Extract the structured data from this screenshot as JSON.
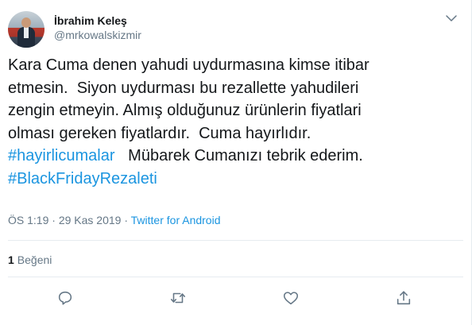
{
  "author": {
    "display_name": "İbrahim Keleş",
    "handle": "@mrkowalskizmir"
  },
  "tweet": {
    "text_lines": [
      "Kara Cuma denen yahudi uydurmasına kimse itibar",
      "etmesin.  Siyon uydurması bu rezallette yahudileri",
      "zengin etmeyin. Almış olduğunuz ürünlerin fiyatlari",
      "olması gereken fiyatlardır.  Cuma hayırlıdır."
    ],
    "hashtag1": "#hayirlicumalar",
    "line5_rest": "   Mübarek Cumanızı tebrik ederim.",
    "hashtag2": "#BlackFridayRezaleti"
  },
  "meta": {
    "time": "ÖS 1:19",
    "separator": " · ",
    "date": "29 Kas 2019",
    "source": "Twitter for Android"
  },
  "stats": {
    "like_count": "1",
    "like_label": "Beğeni"
  },
  "actions": {
    "reply_icon": "reply-icon",
    "retweet_icon": "retweet-icon",
    "like_icon": "heart-icon",
    "share_icon": "share-icon"
  },
  "colors": {
    "link": "#1b95e0",
    "muted": "#657786",
    "text": "#14171a",
    "border": "#e6ecf0"
  }
}
